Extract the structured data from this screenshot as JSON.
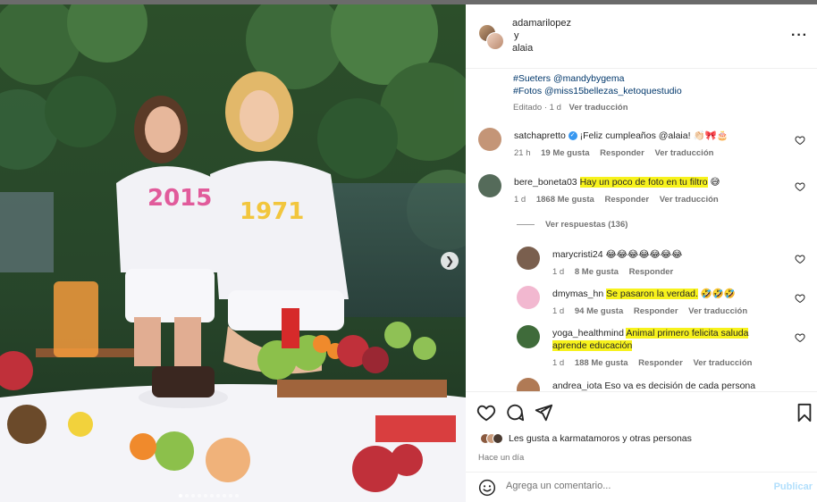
{
  "header": {
    "user1": "adamarilopez",
    "conjunction": "y",
    "user2": "alaia",
    "more_icon": "more-horizontal-icon"
  },
  "caption": {
    "line1": "#Sueters @mandybygema",
    "line2": "#Fotos @miss15bellezas_ketoquestudio",
    "edited": "Editado · 1 d",
    "translation": "Ver traducción"
  },
  "comments": [
    {
      "user": "satchapretto",
      "verified": true,
      "text_plain": "¡Feliz cumpleaños @alaia! ",
      "text_highlight": "",
      "text_extra": "👏🏻🎀🎂",
      "time": "21 h",
      "likes": "19 Me gusta",
      "reply": "Responder",
      "translation": "Ver traducción",
      "avatar_color": "#c49577"
    },
    {
      "user": "bere_boneta03",
      "verified": false,
      "text_plain": "",
      "text_highlight": "Hay un poco de foto en tu filtro",
      "text_extra": " 😅",
      "time": "1 d",
      "likes": "1868 Me gusta",
      "reply": "Responder",
      "translation": "Ver traducción",
      "view_replies": "Ver respuestas (136)",
      "avatar_color": "#556b5a"
    }
  ],
  "replies": [
    {
      "user": "marycristi24",
      "text_plain": "😂😂😂😂😂😂😂",
      "text_highlight": "",
      "time": "1 d",
      "likes": "8 Me gusta",
      "reply": "Responder",
      "translation": "",
      "avatar_color": "#7a5f4e"
    },
    {
      "user": "dmymas_hn",
      "text_plain": "",
      "text_highlight": "Se pasaron la verdad.",
      "text_extra": " 🤣🤣🤣",
      "time": "1 d",
      "likes": "94 Me gusta",
      "reply": "Responder",
      "translation": "Ver traducción",
      "avatar_color": "#f2b8d0"
    },
    {
      "user": "yoga_healthmind",
      "text_highlight": "Animal primero felicita saluda",
      "text_highlight2": "aprende educación",
      "time": "1 d",
      "likes": "188 Me gusta",
      "reply": "Responder",
      "translation": "Ver traducción",
      "avatar_color": "#3f6b3a"
    },
    {
      "user": "andrea_iota",
      "text_plain": "Eso va es decisión de cada persona",
      "avatar_color": "#b07a55"
    }
  ],
  "actions": {
    "like_icon": "heart-icon",
    "comment_icon": "comment-icon",
    "share_icon": "share-icon",
    "save_icon": "bookmark-icon",
    "liked_by_prefix": "Les gusta a ",
    "liked_by_user": "karmatamoros",
    "liked_by_suffix": " y otras personas",
    "time": "Hace un día"
  },
  "add_comment": {
    "placeholder": "Agrega un comentario...",
    "publish": "Publicar",
    "emoji_icon": "emoji-icon"
  },
  "photo": {
    "next_icon": "chevron-right-icon",
    "carousel_count": 10,
    "carousel_active": 0,
    "colors": {
      "foliage": "#2f5a31",
      "sweater": "#f2f2f6",
      "hair_girl": "#5a3a27",
      "hair_woman": "#e2b86a",
      "blanket": "#f4f4f8"
    }
  },
  "colors": {
    "highlight": "#f7f21c",
    "link": "#00376b",
    "muted": "#737373",
    "publish": "#b2dffc",
    "verified": "#3797f0"
  }
}
